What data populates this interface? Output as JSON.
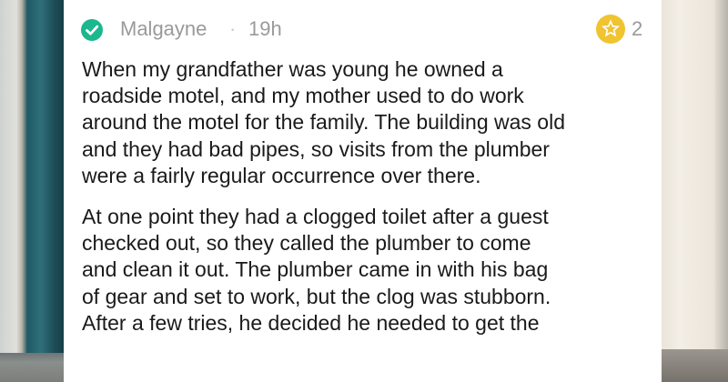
{
  "post": {
    "author": "Malgayne",
    "separator": "·",
    "age": "19h",
    "award_count": "2",
    "icons": {
      "verified": "check-circle-icon",
      "award": "star-badge-icon"
    },
    "colors": {
      "verified": "#1bb78f",
      "award": "#f0c330",
      "meta_text": "#9a9a9a",
      "body_text": "#1a1a1a"
    },
    "paragraphs": [
      {
        "lines": [
          "When my grandfather was young he owned a",
          "roadside motel, and my mother used to do work",
          "around the motel for the family. The building was old",
          "and they had bad pipes, so visits from the plumber",
          "were a fairly regular occurrence over there."
        ]
      },
      {
        "lines": [
          "At one point they had a clogged toilet after a guest",
          "checked out, so they called the plumber to come",
          "and clean it out. The plumber came in with his bag",
          "of gear and set to work, but the clog was stubborn.",
          "After a few tries, he decided he needed to get the"
        ]
      }
    ]
  }
}
